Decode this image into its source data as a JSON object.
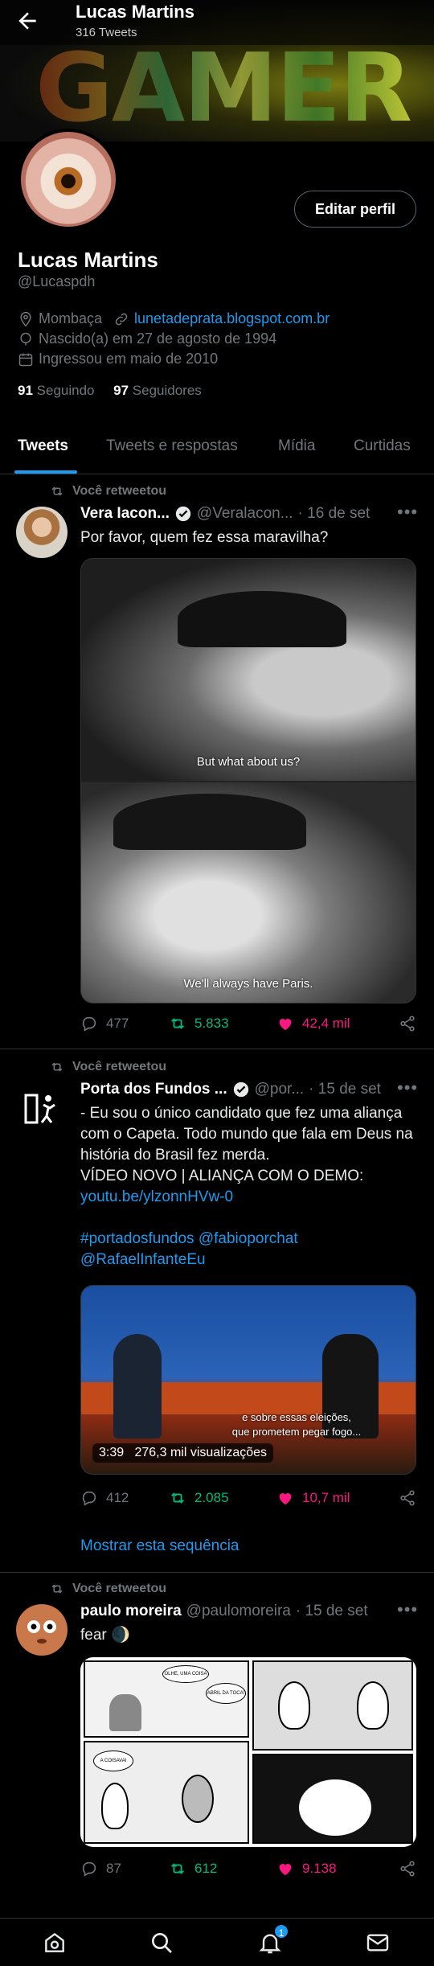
{
  "header": {
    "title": "Lucas Martins",
    "subtitle": "316 Tweets",
    "banner_text": "GAMER"
  },
  "profile": {
    "name": "Lucas Martins",
    "handle": "@Lucaspdh",
    "edit_label": "Editar perfil",
    "location": "Mombaça",
    "website": "lunetadeprata.blogspot.com.br",
    "birth": "Nascido(a) em 27 de agosto de 1994",
    "joined": "Ingressou em maio de 2010",
    "following_count": "91",
    "following_label": "Seguindo",
    "followers_count": "97",
    "followers_label": "Seguidores"
  },
  "tabs": [
    "Tweets",
    "Tweets e respostas",
    "Mídia",
    "Curtidas"
  ],
  "tweets": [
    {
      "retweet_label": "Você retweetou",
      "name": "Vera Iacon...",
      "handle": "@Veralacon...",
      "date": "· 16 de set",
      "text": "Por favor, quem fez essa maravilha?",
      "media_sub_top": "But what about us?",
      "media_sub_bottom": "We'll always have Paris.",
      "replies": "477",
      "retweets": "5.833",
      "likes": "42,4 mil"
    },
    {
      "retweet_label": "Você retweetou",
      "name": "Porta dos Fundos ...",
      "handle": "@por...",
      "date": "· 15 de set",
      "text_1": "- Eu sou o único candidato que fez uma aliança com o Capeta. Todo mundo que fala em Deus na história do Brasil fez merda.",
      "text_2": "VÍDEO NOVO | ALIANÇA COM O DEMO:",
      "link": "youtu.be/ylzonnHVw-0",
      "hashtags": "#portadosfundos @fabioporchat",
      "mention": "@RafaelInfanteEu",
      "video_caption_1": "e sobre essas eleições,",
      "video_caption_2": "que prometem pegar fogo...",
      "video_duration": "3:39",
      "video_views": "276,3 mil visualizações",
      "replies": "412",
      "retweets": "2.085",
      "likes": "10,7 mil",
      "show_thread": "Mostrar esta sequência"
    },
    {
      "retweet_label": "Você retweetou",
      "name": "paulo moreira",
      "handle": "@paulomoreira",
      "date": "· 15 de set",
      "text": "fear 🌒",
      "comic_bubble_1": "OLHE, UMA COISA FEIA!",
      "comic_bubble_2": "ABRIL DA TOCA!",
      "comic_bubble_3": "A COISAVAI SUMINDO...",
      "replies": "87",
      "retweets": "612",
      "likes": "9.138"
    }
  ],
  "notifications_badge": "1",
  "colors": {
    "accent": "#1d9bf0",
    "retweet": "#00ba7c",
    "like": "#f91880",
    "muted": "#71767b"
  }
}
